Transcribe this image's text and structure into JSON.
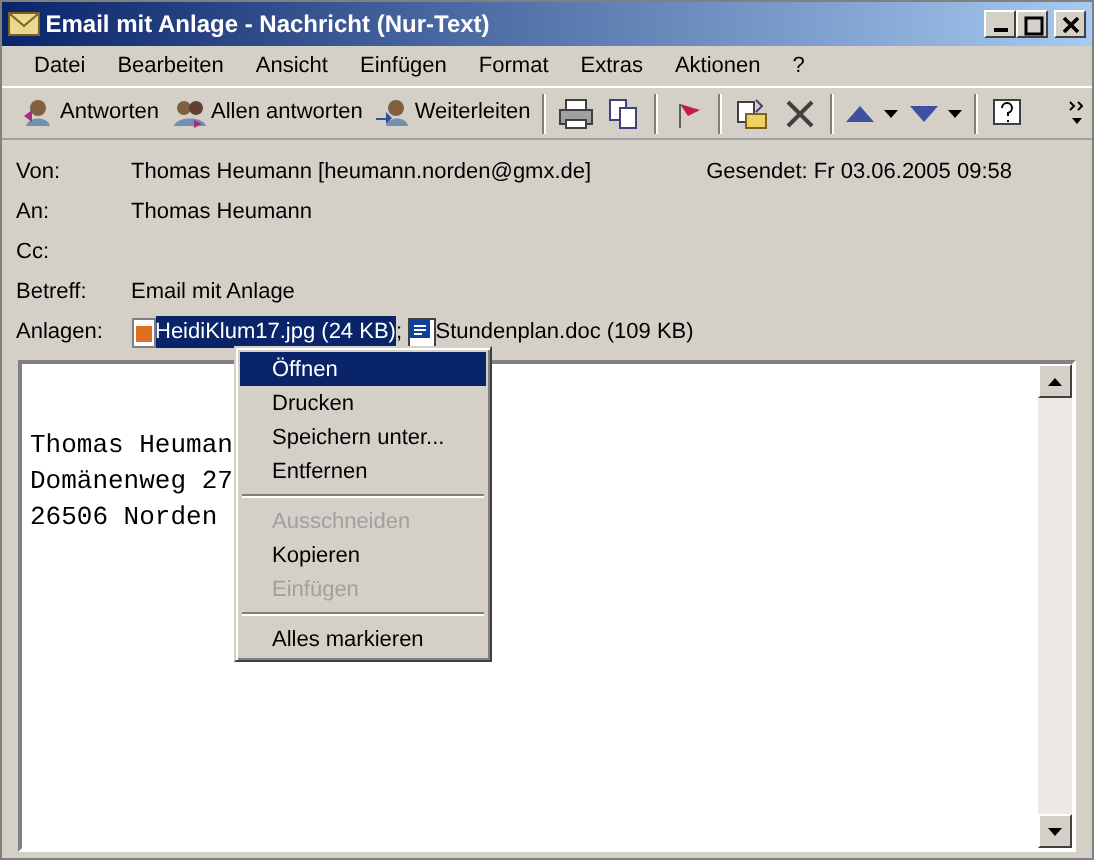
{
  "window": {
    "title": "Email mit Anlage - Nachricht (Nur-Text)"
  },
  "menu_bar": [
    "Datei",
    "Bearbeiten",
    "Ansicht",
    "Einfügen",
    "Format",
    "Extras",
    "Aktionen",
    "?"
  ],
  "toolbar": [
    {
      "kind": "text",
      "label": "Antworten"
    },
    {
      "kind": "text",
      "label": "Allen antworten"
    },
    {
      "kind": "text",
      "label": "Weiterleiten"
    },
    {
      "kind": "sep"
    },
    {
      "kind": "icon"
    },
    {
      "kind": "icon"
    },
    {
      "kind": "sep"
    },
    {
      "kind": "icon"
    },
    {
      "kind": "sep"
    },
    {
      "kind": "icon"
    },
    {
      "kind": "icon"
    },
    {
      "kind": "sep"
    },
    {
      "kind": "dropdown"
    },
    {
      "kind": "dropdown"
    },
    {
      "kind": "sep"
    },
    {
      "kind": "icon"
    }
  ],
  "header": {
    "fields": [
      {
        "label": "Von:",
        "value": "Thomas Heumann [heumann.norden@gmx.de]"
      },
      {
        "label": "An:",
        "value": "Thomas Heumann"
      },
      {
        "label": "Cc:"
      },
      {
        "label": "Betreff:",
        "value": "Email mit Anlage"
      }
    ],
    "sent": "Gesendet: Fr 03.06.2005 09:58",
    "attachments_label": "Anlagen:",
    "attachments": [
      {
        "name": "HeidiKlum17.jpg (24 KB)",
        "selected": true
      },
      {
        "name": "Stundenplan.doc (109 KB)",
        "selected": false
      }
    ],
    "attachment_separator": ";"
  },
  "body": {
    "lines": [
      "Thomas Heuman",
      "Domänenweg 27",
      "26506 Norden"
    ]
  },
  "context_menu": [
    {
      "kind": "item",
      "label": "Öffnen",
      "selected": true,
      "disabled": false
    },
    {
      "kind": "item",
      "label": "Drucken",
      "selected": false,
      "disabled": false
    },
    {
      "kind": "item",
      "label": "Speichern unter...",
      "selected": false,
      "disabled": false
    },
    {
      "kind": "item",
      "label": "Entfernen",
      "selected": false,
      "disabled": false
    },
    {
      "kind": "sep"
    },
    {
      "kind": "item",
      "label": "Ausschneiden",
      "selected": false,
      "disabled": true
    },
    {
      "kind": "item",
      "label": "Kopieren",
      "selected": false,
      "disabled": false
    },
    {
      "kind": "item",
      "label": "Einfügen",
      "selected": false,
      "disabled": true
    },
    {
      "kind": "sep"
    },
    {
      "kind": "item",
      "label": "Alles markieren",
      "selected": false,
      "disabled": false
    }
  ]
}
